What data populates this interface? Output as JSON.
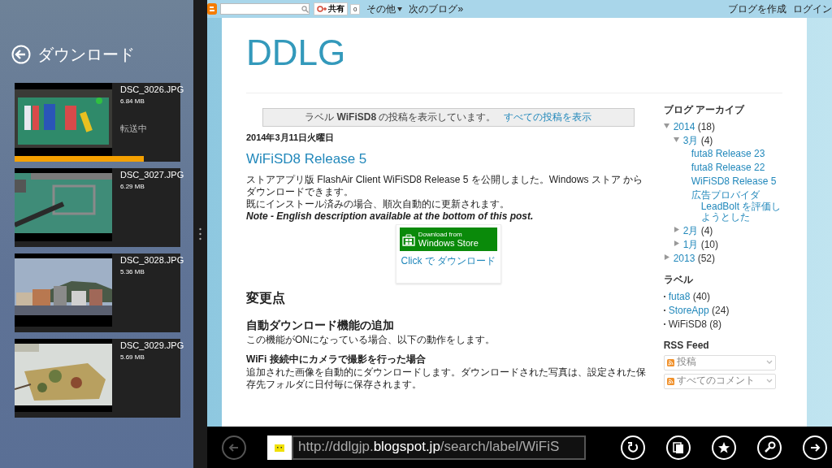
{
  "downloads_pane": {
    "title": "ダウンロード",
    "items": [
      {
        "name": "DSC_3026.JPG",
        "size": "6.84 MB",
        "status": "転送中",
        "level": 0.78
      },
      {
        "name": "DSC_3027.JPG",
        "size": "6.29 MB"
      },
      {
        "name": "DSC_3028.JPG",
        "size": "5.36 MB"
      },
      {
        "name": "DSC_3029.JPG",
        "size": "5.69 MB"
      }
    ]
  },
  "navbar": {
    "share_label": "共有",
    "share_count": "0",
    "more": "その他",
    "next_blog": "次のブログ»",
    "create_blog": "ブログを作成",
    "login": "ログイン"
  },
  "blog": {
    "title": "DDLG",
    "status_message": "ラベル **WiFiSD8** の投稿を表示しています。",
    "show_all": "すべての投稿を表示",
    "date": "2014年3月11日火曜日",
    "post_title": "WiFiSD8 Release 5",
    "intro": [
      {
        "kind": "text",
        "text": "ストアアプリ版 FlashAir Client WiFiSD8 Release 5 を公開しました。Windows ストア からダウンロードできます。"
      },
      {
        "kind": "text",
        "text": "既にインストール済みの場合、順次自動的に更新されます。"
      },
      {
        "kind": "note",
        "text": "Note - English description available at the bottom of this post."
      }
    ],
    "store_badge": {
      "line_1": "Download from",
      "line_2": "Windows Store",
      "link": "Click で ダウンロード"
    },
    "body": [
      {
        "kind": "h2",
        "text": "変更点"
      },
      {
        "kind": "h3",
        "text": "自動ダウンロード機能の追加"
      },
      {
        "kind": "text",
        "text": "この機能がONになっている場合、以下の動作をします。"
      },
      {
        "kind": "h4",
        "text": "WiFi 接続中にカメラで撮影を行った場合"
      },
      {
        "kind": "text",
        "text": "追加された画像を自動的にダウンロードします。ダウンロードされた写真は、設定された保存先フォルダに日付毎に保存されます。"
      }
    ]
  },
  "sidebar": {
    "archive_title": "ブログ アーカイブ",
    "archive": [
      {
        "label": "2014",
        "count": "(18)",
        "expanded": true,
        "children": [
          {
            "label": "3月",
            "count": "(4)",
            "expanded": true,
            "children": [
              {
                "label": "futa8 Release 23"
              },
              {
                "label": "futa8 Release 22"
              },
              {
                "label": "WiFiSD8 Release 5"
              },
              {
                "label": "広告プロバイダ LeadBolt を評価しようとした"
              }
            ]
          },
          {
            "label": "2月",
            "count": "(4)",
            "expanded": false
          },
          {
            "label": "1月",
            "count": "(10)",
            "expanded": false
          }
        ]
      },
      {
        "label": "2013",
        "count": "(52)",
        "expanded": false
      }
    ],
    "labels_title": "ラベル",
    "labels": [
      {
        "label": "futa8",
        "count": "(40)",
        "selected": false
      },
      {
        "label": "StoreApp",
        "count": "(24)",
        "selected": false
      },
      {
        "label": "WiFiSD8",
        "count": "(8)",
        "selected": true
      }
    ],
    "rss_title": "RSS Feed",
    "feeds": [
      "投稿",
      "すべてのコメント"
    ]
  },
  "address_bar": {
    "back_disabled": true,
    "url": "http://ddlgjp.**blogspot.jp**/search/label/WiFiS"
  }
}
